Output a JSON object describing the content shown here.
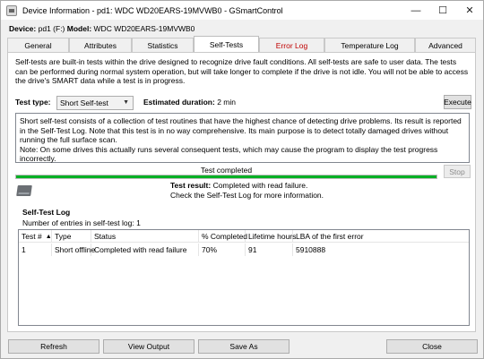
{
  "window": {
    "title": "Device Information - pd1: WDC WD20EARS-19MVWB0 - GSmartControl",
    "minimize": "—",
    "maximize": "☐",
    "close": "✕"
  },
  "device": {
    "device_label": "Device:",
    "device_value": "pd1 (F:)",
    "model_label": "Model:",
    "model_value": "WDC WD20EARS-19MVWB0"
  },
  "tabs": [
    "General",
    "Attributes",
    "Statistics",
    "Self-Tests",
    "Error Log",
    "Temperature Log",
    "Advanced"
  ],
  "selftests": {
    "intro": "Self-tests are built-in tests within the drive designed to recognize drive fault conditions. All self-tests are safe to user data. The tests can be performed during normal system operation, but will take longer to complete if the drive is not idle. You will not be able to access the drive's SMART data while a test is in progress.",
    "test_type_label": "Test type:",
    "test_type_value": "Short Self-test",
    "duration_label": "Estimated duration:",
    "duration_value": "2 min",
    "execute_label": "Execute",
    "description": "Short self-test consists of a collection of test routines that have the highest chance of detecting drive problems. Its result is reported in the Self-Test Log. Note that this test is in no way comprehensive. Its main purpose is to detect totally damaged drives without running the full surface scan.\nNote: On some drives this actually runs several consequent tests, which may cause the program to display the test progress incorrectly.",
    "progress_label": "Test completed",
    "progress_fraction": 1.0,
    "stop_label": "Stop",
    "result_label": "Test result:",
    "result_value": "Completed with read failure.",
    "result_hint": "Check the Self-Test Log for more information."
  },
  "log": {
    "title": "Self-Test Log",
    "count_text": "Number of entries in self-test log: 1",
    "columns": [
      "Test #",
      "Type",
      "Status",
      "% Completed",
      "Lifetime hours",
      "LBA of the first error"
    ],
    "rows": [
      [
        "1",
        "Short offline",
        "Completed with read failure",
        "70%",
        "91",
        "5910888"
      ]
    ]
  },
  "buttons": {
    "refresh": "Refresh",
    "view_output": "View Output",
    "save_as": "Save As",
    "close": "Close"
  },
  "colors": {
    "progress": "#06b025",
    "error_tab": "#c00000"
  }
}
